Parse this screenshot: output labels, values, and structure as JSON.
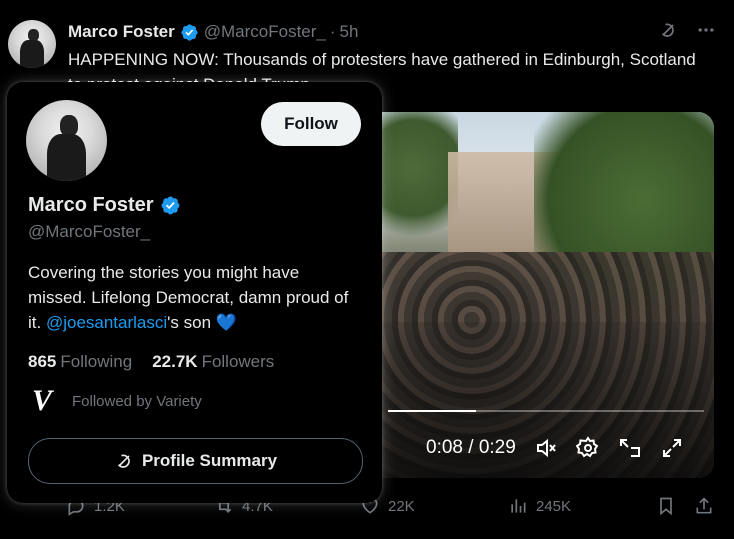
{
  "tweet": {
    "author_name": "Marco Foster",
    "author_handle": "@MarcoFoster_",
    "dot": "·",
    "time": "5h",
    "text": "HAPPENING NOW: Thousands of protesters have gathered in Edinburgh, Scotland to protest against Donald Trump",
    "icons": {
      "grok": "grok-icon",
      "more": "more-icon"
    }
  },
  "video": {
    "time_display": "0:08 / 0:29",
    "progress": 0.28
  },
  "actions": {
    "replies": "1.2K",
    "reposts": "4.7K",
    "likes": "22K",
    "views": "245K"
  },
  "hover_card": {
    "follow_label": "Follow",
    "name": "Marco Foster",
    "handle": "@MarcoFoster_",
    "bio_before": "Covering the stories you might have missed. Lifelong Democrat, damn proud of it. ",
    "bio_link": "@joesantarlasci",
    "bio_after": "'s son ",
    "bio_emoji": "💙",
    "following_count": "865",
    "following_label": "Following",
    "followers_count": "22.7K",
    "followers_label": "Followers",
    "followed_by_logo": "V",
    "followed_by_text": "Followed by Variety",
    "summary_label": "Profile Summary"
  },
  "colors": {
    "accent": "#1d9bf0",
    "muted": "#71767b",
    "background": "#000000"
  }
}
